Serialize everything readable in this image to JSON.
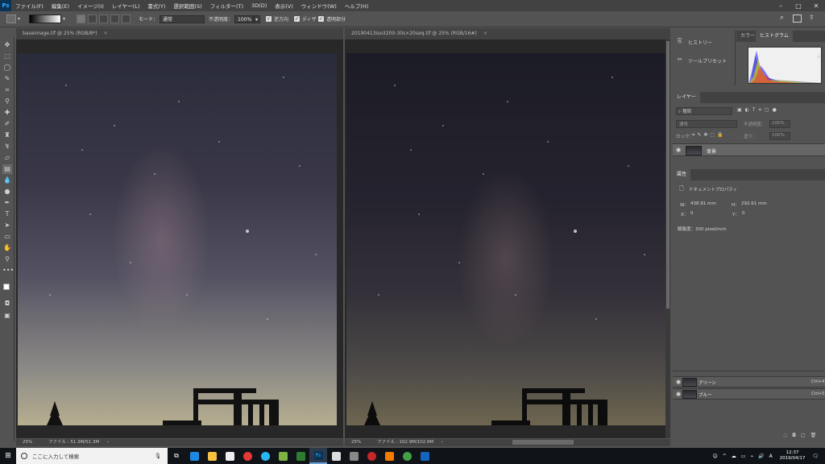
{
  "app": {
    "logo": "Ps",
    "accent": "#31a8ff"
  },
  "menu": [
    "ファイル(F)",
    "編集(E)",
    "イメージ(I)",
    "レイヤー(L)",
    "書式(Y)",
    "選択範囲(S)",
    "フィルター(T)",
    "3D(D)",
    "表示(V)",
    "ウィンドウ(W)",
    "ヘルプ(H)"
  ],
  "options": {
    "mode_label": "モード：",
    "mode_value": "通常",
    "opacity_label": "不透明度：",
    "opacity_value": "100%",
    "reverse_label": "逆方向",
    "dither_label": "ディザ",
    "transparency_label": "透明部分"
  },
  "doc1": {
    "tab": "baseimage.tif @ 25% (RGB/8*)",
    "zoom": "25%",
    "file": "ファイル : 51.3M/51.3M"
  },
  "doc2": {
    "tab": "20190413iso3200-30s×20seq.tif @ 25% (RGB/16#)",
    "zoom": "25%",
    "file": "ファイル : 102.9M/102.9M"
  },
  "side_panels": {
    "history": "ヒストリー",
    "tool_presets": "ツールプリセット"
  },
  "histogram_tabs": {
    "color": "カラー",
    "histogram": "ヒストグラム"
  },
  "layers": {
    "tab": "レイヤー",
    "kind": "種類",
    "blend": "通常",
    "opacity_label": "不透明度：",
    "opacity_value": "100%",
    "lock_label": "ロック：",
    "fill_label": "塗り：",
    "fill_value": "100%",
    "layer_name": "背景"
  },
  "properties": {
    "tab": "属性",
    "doc_props": "ドキュメントプロパティ",
    "w_label": "W：",
    "w_value": "438.91 mm",
    "h_label": "H：",
    "h_value": "292.61 mm",
    "x_label": "X：",
    "x_value": "0",
    "y_label": "Y：",
    "y_value": "0",
    "resolution": "解像度：300 pixel/inch"
  },
  "channels": [
    {
      "name": "グリーン",
      "shortcut": "Ctrl+4"
    },
    {
      "name": "ブルー",
      "shortcut": "Ctrl+5"
    }
  ],
  "taskbar": {
    "search_placeholder": "ここに入力して検索",
    "time": "12:37",
    "date": "2019/04/17",
    "ime": "A"
  }
}
